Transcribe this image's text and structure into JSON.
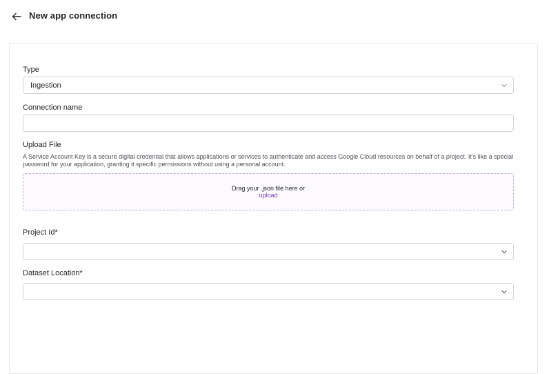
{
  "header": {
    "title": "New app connection",
    "back_icon": "arrow-left-icon"
  },
  "form": {
    "type": {
      "label": "Type",
      "value": "Ingestion"
    },
    "connection_name": {
      "label": "Connection name",
      "value": ""
    },
    "upload": {
      "label": "Upload File",
      "description": "A Service Account Key is a secure digital credential that allows applications or services to authenticate and access Google Cloud resources on behalf of a project. It's like a special password for your application, granting it specific permissions without using a personal account.",
      "drop_text": "Drag your .json file here or",
      "upload_link": "upload"
    },
    "project_id": {
      "label": "Project Id*",
      "value": ""
    },
    "dataset_location": {
      "label": "Dataset Location*",
      "value": ""
    }
  },
  "colors": {
    "accent": "#7b3fc4",
    "dropzone_border": "#c7a5e6",
    "border": "#cfd3d8"
  }
}
